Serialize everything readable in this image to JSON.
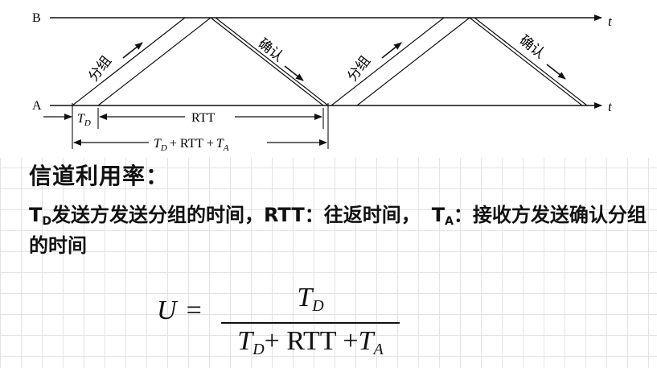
{
  "diagram": {
    "station_b": "B",
    "station_a": "A",
    "time_axis": "t",
    "packet_label": "分组",
    "ack_label": "确认",
    "td_label": "T",
    "td_sub": "D",
    "rtt_label": "RTT",
    "total_label": "T",
    "total_sub1": "D",
    "total_mid": "+ RTT +",
    "total_label2": "T",
    "total_sub2": "A"
  },
  "title": "信道利用率：",
  "description": {
    "td_symbol": "T",
    "td_sub": "D",
    "td_text": "发送方发送分组的时间，",
    "rtt_symbol": "RTT",
    "rtt_text": "：往返时间，",
    "ta_symbol": "T",
    "ta_sub": "A",
    "ta_text": "：接收方发送确认分组的时间"
  },
  "formula": {
    "lhs": "U",
    "equals": "=",
    "num_symbol": "T",
    "num_sub": "D",
    "den_t1": "T",
    "den_sub1": "D",
    "den_mid": "+ RTT +",
    "den_t2": "T",
    "den_sub2": "A"
  }
}
